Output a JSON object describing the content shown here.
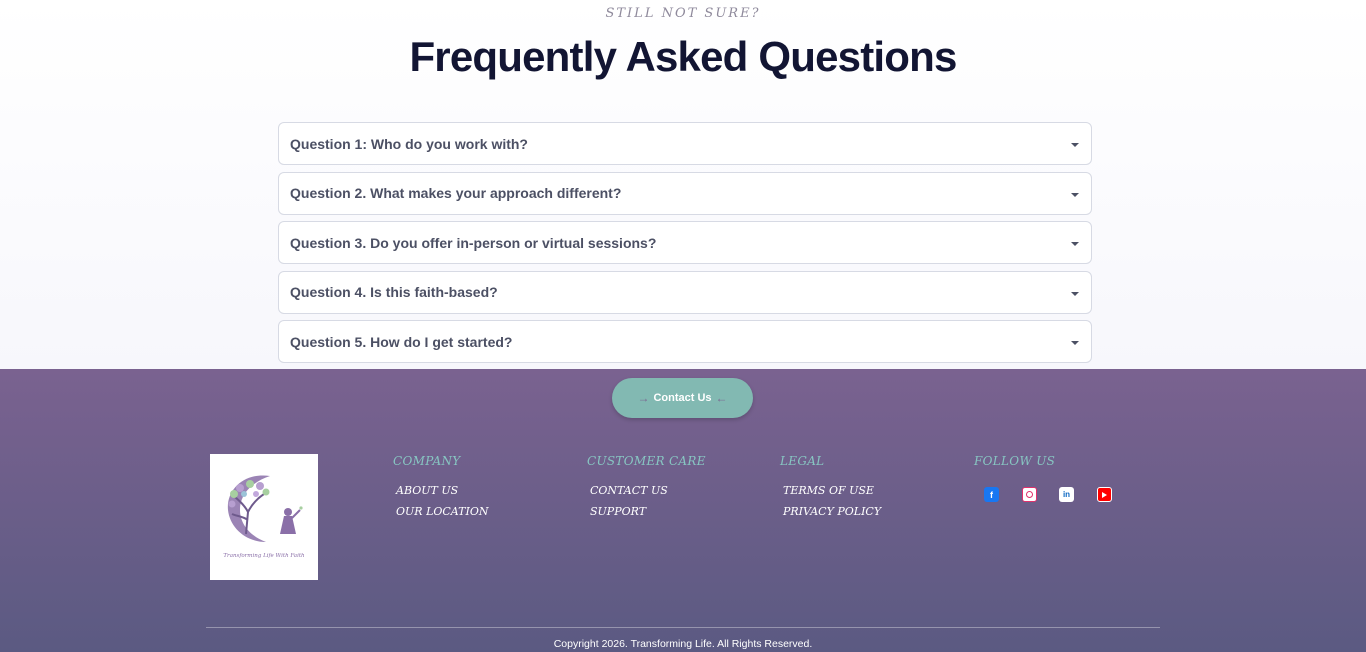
{
  "faq": {
    "eyebrow": "STILL NOT SURE?",
    "title": "Frequently Asked Questions",
    "questions": [
      "Question 1: Who do you work with?",
      "Question 2. What makes your approach different?",
      "Question 3. Do you offer in-person or virtual sessions?",
      "Question 4. Is this faith-based?",
      "Question 5. How do I get started?"
    ]
  },
  "footer": {
    "contact_label": "Contact Us",
    "logo_text": "Transforming Life With Faith",
    "columns": [
      {
        "heading": "COMPANY",
        "links": [
          "ABOUT US",
          "OUR LOCATION"
        ]
      },
      {
        "heading": "CUSTOMER CARE",
        "links": [
          "CONTACT US",
          "SUPPORT"
        ]
      },
      {
        "heading": "LEGAL",
        "links": [
          "TERMS OF USE",
          "PRIVACY POLICY"
        ]
      },
      {
        "heading": "FOLLOW US",
        "links": []
      }
    ],
    "social_icons": [
      "facebook-icon",
      "instagram-icon",
      "linkedin-icon",
      "youtube-icon"
    ],
    "copyright": "Copyright 2026. Transforming Life. All Rights Reserved."
  },
  "colors": {
    "title": "#121533",
    "footer_top": "#7a6290",
    "footer_bottom": "#5b5a82",
    "accent_teal": "#82b9b2",
    "heading_teal": "#87c6c2"
  }
}
